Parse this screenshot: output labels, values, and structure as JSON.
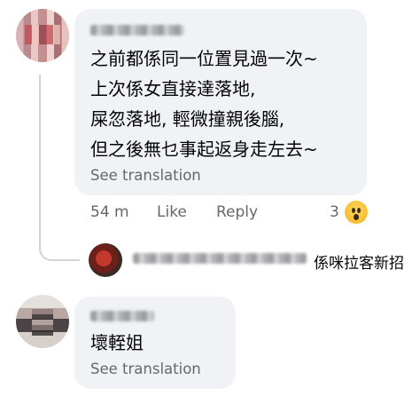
{
  "comments": [
    {
      "lines": [
        "之前都係同一位置見過一次~",
        "上次係女直接達落地,",
        "屎忽落地, 輕微撞親後腦,",
        "但之後無乜事起返身走左去~"
      ],
      "see_translation": "See translation",
      "time": "54 m",
      "like": "Like",
      "reply": "Reply",
      "reaction_count": "3",
      "reaction_icon": "wow-reaction-icon"
    },
    {
      "reply_preview": "係咪拉客新招"
    },
    {
      "lines": [
        "壞輊姐"
      ],
      "see_translation": "See translation"
    }
  ],
  "colors": {
    "bubble": "#f0f2f5",
    "secondary_text": "#65676b",
    "primary_text": "#050505",
    "reaction": "#f7b125"
  }
}
